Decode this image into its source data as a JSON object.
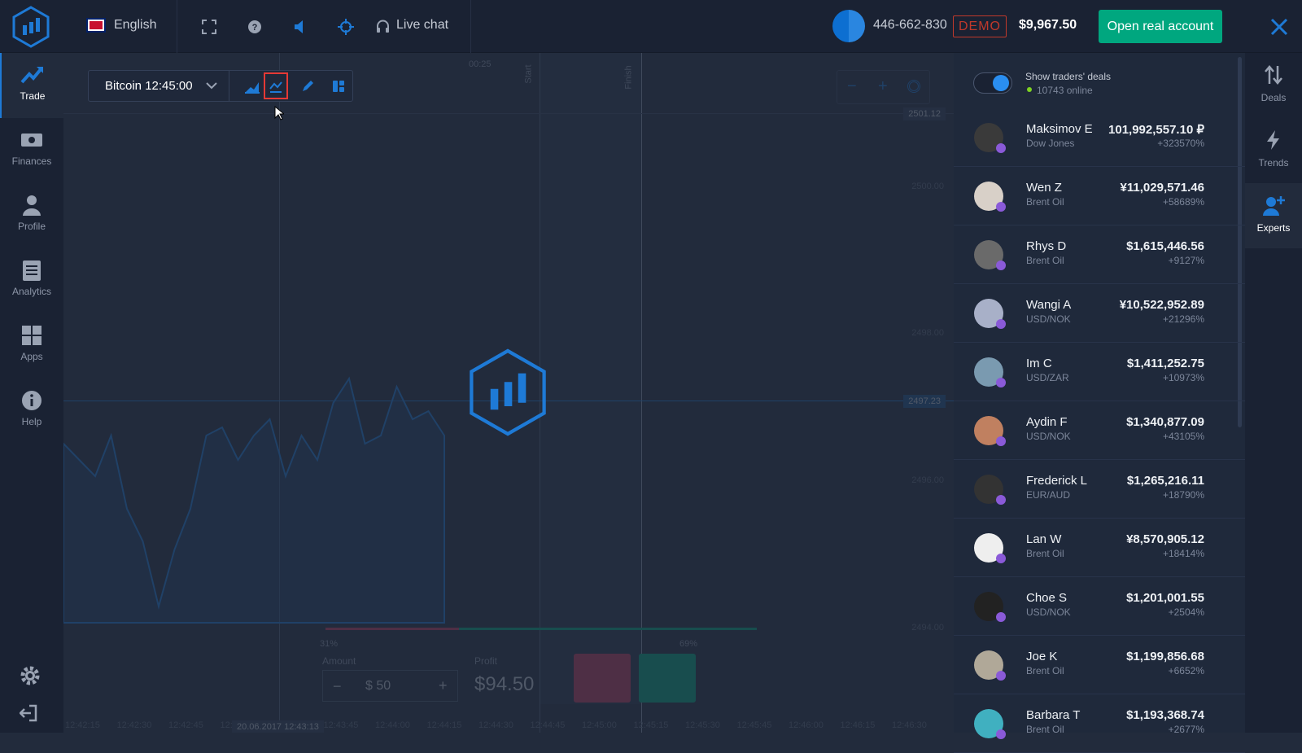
{
  "topbar": {
    "language": "English",
    "live_chat": "Live chat",
    "account_id": "446-662-830",
    "mode_badge": "DEMO",
    "balance": "$9,967.50",
    "open_real_account": "Open real account"
  },
  "sidebar": {
    "items": [
      {
        "label": "Trade",
        "icon": "trend-up-icon"
      },
      {
        "label": "Finances",
        "icon": "cash-icon"
      },
      {
        "label": "Profile",
        "icon": "user-icon"
      },
      {
        "label": "Analytics",
        "icon": "document-icon"
      },
      {
        "label": "Apps",
        "icon": "grid-icon"
      },
      {
        "label": "Help",
        "icon": "info-icon"
      }
    ]
  },
  "toolbar": {
    "asset": "Bitcoin 12:45:00"
  },
  "chart": {
    "timer": "00:25",
    "start_label": "Start",
    "finish_label": "Finish",
    "price_high": "2501.12",
    "price_current": "2497.23",
    "y_ticks": [
      "2500.00",
      "2498.00",
      "2496.00",
      "2494.00"
    ],
    "x_ticks": [
      "12:42:15",
      "12:42:30",
      "12:42:45",
      "12:4",
      "12:43:30",
      "12:43:45",
      "12:44:00",
      "12:44:15",
      "12:44:30",
      "12:44:45",
      "12:45:00",
      "12:45:15",
      "12:45:30",
      "12:45:45",
      "12:46:00",
      "12:46:15",
      "12:46:30"
    ],
    "cursor_time": "20.06.2017 12:43:13"
  },
  "trade_panel": {
    "down_pct": "31%",
    "up_pct": "69%",
    "down_share": 31,
    "amount_label": "Amount",
    "amount": "$ 50",
    "minus": "−",
    "plus": "+",
    "profit_label": "Profit",
    "profit": "$94.50"
  },
  "experts": {
    "show_deals": "Show traders' deals",
    "online": "10743 online",
    "toggle_on": true,
    "list": [
      {
        "name": "Maksimov E",
        "asset": "Dow Jones",
        "amount": "101,992,557.10 ₽",
        "pct": "+323570%"
      },
      {
        "name": "Wen Z",
        "asset": "Brent Oil",
        "amount": "¥11,029,571.46",
        "pct": "+58689%"
      },
      {
        "name": "Rhys D",
        "asset": "Brent Oil",
        "amount": "$1,615,446.56",
        "pct": "+9127%"
      },
      {
        "name": "Wangi A",
        "asset": "USD/NOK",
        "amount": "¥10,522,952.89",
        "pct": "+21296%"
      },
      {
        "name": "Im C",
        "asset": "USD/ZAR",
        "amount": "$1,411,252.75",
        "pct": "+10973%"
      },
      {
        "name": "Aydin F",
        "asset": "USD/NOK",
        "amount": "$1,340,877.09",
        "pct": "+43105%"
      },
      {
        "name": "Frederick L",
        "asset": "EUR/AUD",
        "amount": "$1,265,216.11",
        "pct": "+18790%"
      },
      {
        "name": "Lan W",
        "asset": "Brent Oil",
        "amount": "¥8,570,905.12",
        "pct": "+18414%"
      },
      {
        "name": "Choe S",
        "asset": "USD/NOK",
        "amount": "$1,201,001.55",
        "pct": "+2504%"
      },
      {
        "name": "Joe K",
        "asset": "Brent Oil",
        "amount": "$1,199,856.68",
        "pct": "+6652%"
      },
      {
        "name": "Barbara T",
        "asset": "Brent Oil",
        "amount": "$1,193,368.74",
        "pct": "+2677%"
      }
    ]
  },
  "right_nav": {
    "items": [
      {
        "label": "Deals",
        "icon": "arrows-updown-icon"
      },
      {
        "label": "Trends",
        "icon": "lightning-icon"
      },
      {
        "label": "Experts",
        "icon": "add-user-icon"
      }
    ]
  },
  "colors": {
    "accent": "#1e7ad6",
    "green": "#00a77f",
    "demo": "#c0392b",
    "online": "#7ed321"
  }
}
